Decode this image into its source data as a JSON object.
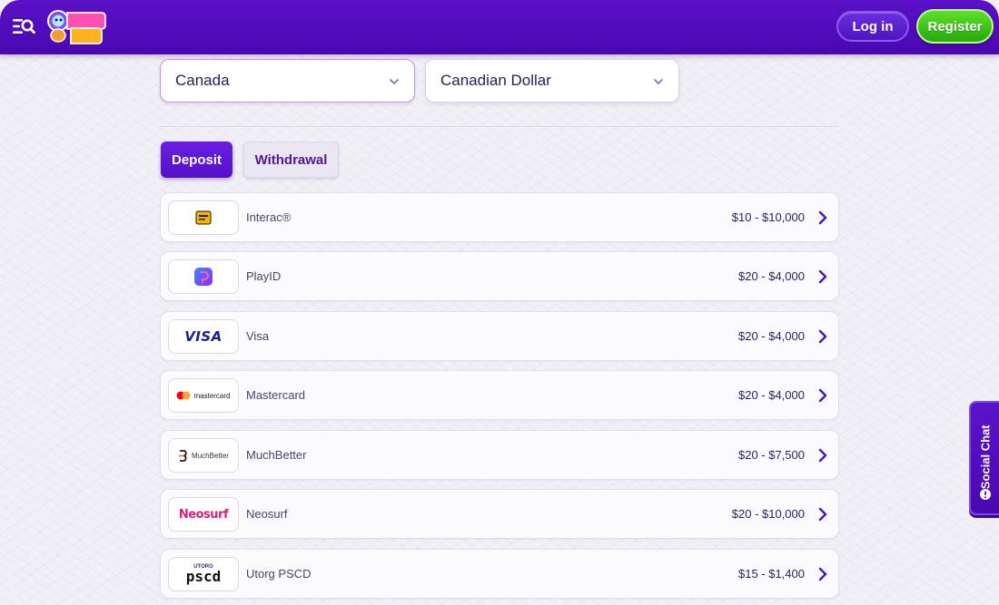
{
  "header": {
    "brand_logo_icon": "robocat-logo-icon",
    "menu_icon": "menu-search-icon",
    "login_label": "Log in",
    "register_label": "Register"
  },
  "filters": {
    "country": "Canada",
    "currency": "Canadian Dollar"
  },
  "tabs": [
    {
      "label": "Deposit",
      "active": true
    },
    {
      "label": "Withdrawal",
      "active": false
    }
  ],
  "methods": [
    {
      "name": "Interac®",
      "range": "$10 - $10,000",
      "icon": "interac-logo-icon"
    },
    {
      "name": "PlayID",
      "range": "$20 - $4,000",
      "icon": "playid-logo-icon"
    },
    {
      "name": "Visa",
      "range": "$20 - $4,000",
      "icon": "visa-logo-icon",
      "logo_text": "VISA"
    },
    {
      "name": "Mastercard",
      "range": "$20 - $4,000",
      "icon": "mastercard-logo-icon",
      "logo_text": "mastercard"
    },
    {
      "name": "MuchBetter",
      "range": "$20 - $7,500",
      "icon": "muchbetter-logo-icon",
      "logo_text": "MuchBetter"
    },
    {
      "name": "Neosurf",
      "range": "$20 - $10,000",
      "icon": "neosurf-logo-icon",
      "logo_text": "Neosurf"
    },
    {
      "name": "Utorg PSCD",
      "range": "$15 - $1,400",
      "icon": "utorg-pscd-logo-icon",
      "logo_text_top": "UTORG",
      "logo_text_main": "pscd"
    }
  ],
  "social_chat": {
    "label": "Social Chat"
  },
  "colors": {
    "header": "#5a10c8",
    "register": "#3cc01a",
    "deposit_tab": "#6a1ee0",
    "accent_text": "#2b1d63"
  }
}
